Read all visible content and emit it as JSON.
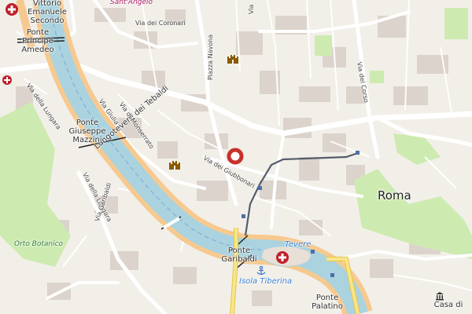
{
  "map": {
    "city_label": "Roma",
    "bridges": {
      "vittorio": [
        "Vittorio",
        "Emanuele",
        "Secondo"
      ],
      "principe": [
        "Ponte",
        "Principe",
        "Amedeo"
      ],
      "mazzini": [
        "Ponte",
        "Giuseppe",
        "Mazzini"
      ],
      "garibaldi": [
        "Ponte",
        "Garibaldi"
      ],
      "palatino": [
        "Ponte",
        "Palatino"
      ]
    },
    "streets": {
      "lungotevere_tebaldi": "Lungotevere dei Tebaldi",
      "via_coronari": "Via dei Coronari",
      "piazza_navona": "Piazza Navona",
      "via_lungara_n": "Via della Lungara",
      "via_giulia": "Via Giulia",
      "via_monserrato": "Via di Monserrato",
      "via_giubbonari": "Via dei Giubbonari",
      "via_lungara_s": "Via della Lungara",
      "via_garibaldi": "Via Garibaldi",
      "via_corso": "Via del Corso",
      "via_top": "Via"
    },
    "pois": {
      "sant_angelo": "Sant'Angelo",
      "orto_botanico": "Orto Botanico",
      "tevere": "Tevere",
      "isola_tiberina": "Isola Tiberina",
      "casa": [
        "Casa di"
      ]
    },
    "colors": {
      "land": "#f2efe9",
      "river": "#aad3df",
      "embankment": "#f7c98f",
      "park": "#cdebb0",
      "road": "#ffffff",
      "tram": "#555d6b",
      "hospital": "#bf1f2a",
      "attraction": "#c8312b"
    },
    "icons": [
      "hospital-icon",
      "castle-icon",
      "location-marker-icon",
      "anchor-icon"
    ]
  }
}
